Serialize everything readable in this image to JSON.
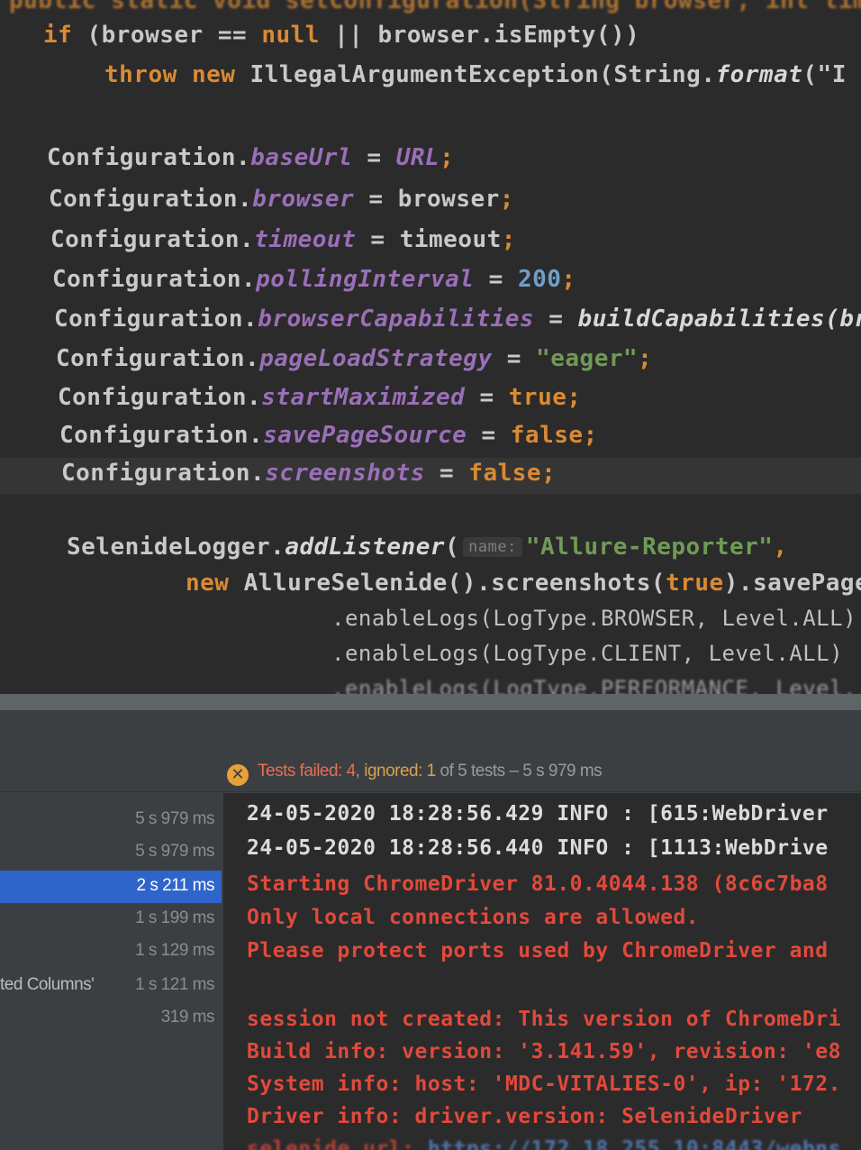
{
  "editor": {
    "line_0": "public static void setConfiguration(String browser, int timeout)",
    "line_1a": "if",
    "line_1b": " (browser == ",
    "line_1c": "null",
    "line_1d": " || browser.isEmpty())",
    "line_2a": "throw",
    "line_2b": "new",
    "line_2c": " IllegalArgumentException(String.",
    "line_2d": "format",
    "line_2e": "(\"I",
    "config_prefix": "Configuration.",
    "l_baseUrl_field": "baseUrl",
    "l_baseUrl_eq": " = ",
    "l_baseUrl_val": "URL",
    "semi": ";",
    "l_browser_field": "browser",
    "l_browser_val": "browser",
    "l_timeout_field": "timeout",
    "l_timeout_val": "timeout",
    "l_polling_field": "pollingInterval",
    "l_polling_val": "200",
    "l_caps_field": "browserCapabilities",
    "l_caps_val": "buildCapabilities(br",
    "l_pls_field": "pageLoadStrategy",
    "l_pls_val": "\"eager\"",
    "l_max_field": "startMaximized",
    "l_max_val": "true",
    "l_sps_field": "savePageSource",
    "l_sps_val": "false",
    "l_shots_field": "screenshots",
    "l_shots_val": "false",
    "logger_prefix": "SelenideLogger.",
    "logger_method": "addListener",
    "logger_paren": "(",
    "logger_hint": "name:",
    "logger_str": "\"Allure-Reporter\"",
    "logger_comma": ",",
    "allure_new": "new",
    "allure_a": " AllureSelenide().screenshots(",
    "allure_true": "true",
    "allure_b": ").savePageS",
    "logs_1": ".enableLogs(LogType.BROWSER, Level.ALL)",
    "logs_2": ".enableLogs(LogType.CLIENT, Level.ALL)",
    "logs_3": ".enableLogs(LogType.PERFORMANCE, Level."
  },
  "status": {
    "failed": "Tests failed: 4",
    "sep": ", ",
    "ignored": "ignored: 1",
    "rest": " of 5 tests – 5 s 979 ms"
  },
  "tree": {
    "rows": [
      {
        "duration": "5 s 979 ms"
      },
      {
        "duration": "5 s 979 ms"
      },
      {
        "duration": "2 s 211 ms"
      },
      {
        "duration": "1 s 199 ms"
      },
      {
        "duration": "1 s 129 ms"
      },
      {
        "label": "ted Columns'",
        "duration": "1 s 121 ms"
      },
      {
        "duration": "319 ms"
      }
    ]
  },
  "console": {
    "lines": [
      "24-05-2020 18:28:56.429 INFO : [615:WebDriver",
      "24-05-2020 18:28:56.440 INFO : [1113:WebDrive",
      "Starting ChromeDriver 81.0.4044.138 (8c6c7ba8",
      "Only local connections are allowed.",
      "Please protect ports used by ChromeDriver and",
      "session not created: This version of ChromeDri",
      "Build info: version: '3.141.59', revision: 'e8",
      "System info: host: 'MDC-VITALIES-0', ip: '172.",
      "Driver info: driver.version: SelenideDriver",
      "selenide.url: ",
      "https://172.18.255.10:8443/webns"
    ]
  },
  "colors": {
    "keyword": "#d98a35",
    "field": "#9a6fb8",
    "number": "#6f9fc8",
    "string": "#6f9b56",
    "error_text": "#e2493b",
    "selection": "#2f65ca",
    "warning_icon": "#e8a03a"
  },
  "icons": {
    "status": "tests-failed-icon"
  }
}
